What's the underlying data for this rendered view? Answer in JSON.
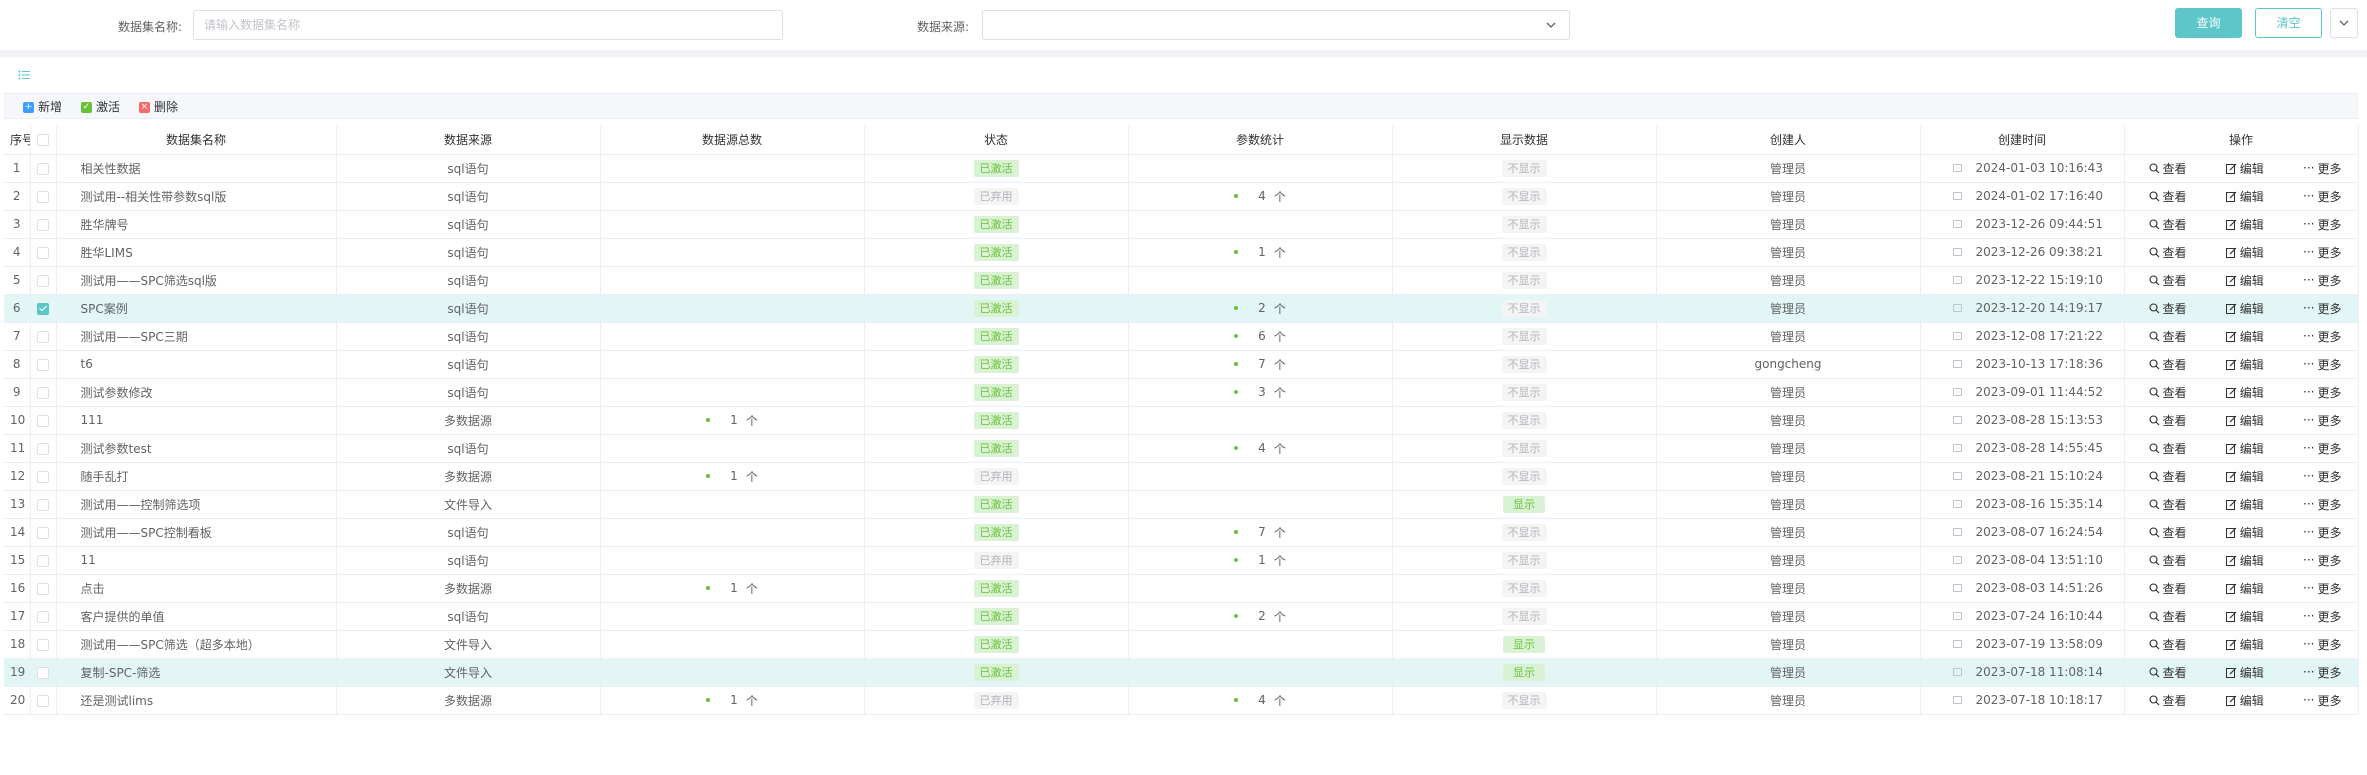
{
  "search": {
    "name_label": "数据集名称:",
    "name_placeholder": "请输入数据集名称",
    "name_value": "",
    "source_label": "数据来源:",
    "source_value": "",
    "query_label": "查询",
    "clear_label": "清空"
  },
  "toolbar": {
    "add_label": "新增",
    "activate_label": "激活",
    "delete_label": "删除"
  },
  "columns": [
    "序号",
    "",
    "数据集名称",
    "数据来源",
    "数据源总数",
    "状态",
    "参数统计",
    "显示数据",
    "创建人",
    "创建时间",
    "操作"
  ],
  "actions": {
    "view": "查看",
    "edit": "编辑",
    "more": "更多"
  },
  "status_labels": {
    "active": "已激活",
    "disabled": "已弃用"
  },
  "display_labels": {
    "show": "显示",
    "hide": "不显示"
  },
  "unit": "个",
  "rows": [
    {
      "no": "1",
      "name": "相关性数据",
      "source": "sql语句",
      "sources_total": "",
      "status": "已激活",
      "params": "",
      "display": "不显示",
      "creator": "管理员",
      "time": "2024-01-03 10:16:43",
      "checked": false,
      "highlight": false
    },
    {
      "no": "2",
      "name": "测试用--相关性带参数sql版",
      "source": "sql语句",
      "sources_total": "",
      "status": "已弃用",
      "params": "4",
      "display": "不显示",
      "creator": "管理员",
      "time": "2024-01-02 17:16:40",
      "checked": false,
      "highlight": false
    },
    {
      "no": "3",
      "name": "胜华牌号",
      "source": "sql语句",
      "sources_total": "",
      "status": "已激活",
      "params": "",
      "display": "不显示",
      "creator": "管理员",
      "time": "2023-12-26 09:44:51",
      "checked": false,
      "highlight": false
    },
    {
      "no": "4",
      "name": "胜华LIMS",
      "source": "sql语句",
      "sources_total": "",
      "status": "已激活",
      "params": "1",
      "display": "不显示",
      "creator": "管理员",
      "time": "2023-12-26 09:38:21",
      "checked": false,
      "highlight": false
    },
    {
      "no": "5",
      "name": "测试用——SPC筛选sql版",
      "source": "sql语句",
      "sources_total": "",
      "status": "已激活",
      "params": "",
      "display": "不显示",
      "creator": "管理员",
      "time": "2023-12-22 15:19:10",
      "checked": false,
      "highlight": false
    },
    {
      "no": "6",
      "name": "SPC案例",
      "source": "sql语句",
      "sources_total": "",
      "status": "已激活",
      "params": "2",
      "display": "不显示",
      "creator": "管理员",
      "time": "2023-12-20 14:19:17",
      "checked": true,
      "highlight": true
    },
    {
      "no": "7",
      "name": "测试用——SPC三期",
      "source": "sql语句",
      "sources_total": "",
      "status": "已激活",
      "params": "6",
      "display": "不显示",
      "creator": "管理员",
      "time": "2023-12-08 17:21:22",
      "checked": false,
      "highlight": false
    },
    {
      "no": "8",
      "name": "t6",
      "source": "sql语句",
      "sources_total": "",
      "status": "已激活",
      "params": "7",
      "display": "不显示",
      "creator": "gongcheng",
      "time": "2023-10-13 17:18:36",
      "checked": false,
      "highlight": false
    },
    {
      "no": "9",
      "name": "测试参数修改",
      "source": "sql语句",
      "sources_total": "",
      "status": "已激活",
      "params": "3",
      "display": "不显示",
      "creator": "管理员",
      "time": "2023-09-01 11:44:52",
      "checked": false,
      "highlight": false
    },
    {
      "no": "10",
      "name": "111",
      "source": "多数据源",
      "sources_total": "1",
      "status": "已激活",
      "params": "",
      "display": "不显示",
      "creator": "管理员",
      "time": "2023-08-28 15:13:53",
      "checked": false,
      "highlight": false
    },
    {
      "no": "11",
      "name": "测试参数test",
      "source": "sql语句",
      "sources_total": "",
      "status": "已激活",
      "params": "4",
      "display": "不显示",
      "creator": "管理员",
      "time": "2023-08-28 14:55:45",
      "checked": false,
      "highlight": false
    },
    {
      "no": "12",
      "name": "随手乱打",
      "source": "多数据源",
      "sources_total": "1",
      "status": "已弃用",
      "params": "",
      "display": "不显示",
      "creator": "管理员",
      "time": "2023-08-21 15:10:24",
      "checked": false,
      "highlight": false
    },
    {
      "no": "13",
      "name": "测试用——控制筛选项",
      "source": "文件导入",
      "sources_total": "",
      "status": "已激活",
      "params": "",
      "display": "显示",
      "creator": "管理员",
      "time": "2023-08-16 15:35:14",
      "checked": false,
      "highlight": false
    },
    {
      "no": "14",
      "name": "测试用——SPC控制看板",
      "source": "sql语句",
      "sources_total": "",
      "status": "已激活",
      "params": "7",
      "display": "不显示",
      "creator": "管理员",
      "time": "2023-08-07 16:24:54",
      "checked": false,
      "highlight": false
    },
    {
      "no": "15",
      "name": "11",
      "source": "sql语句",
      "sources_total": "",
      "status": "已弃用",
      "params": "1",
      "display": "不显示",
      "creator": "管理员",
      "time": "2023-08-04 13:51:10",
      "checked": false,
      "highlight": false
    },
    {
      "no": "16",
      "name": "点击",
      "source": "多数据源",
      "sources_total": "1",
      "status": "已激活",
      "params": "",
      "display": "不显示",
      "creator": "管理员",
      "time": "2023-08-03 14:51:26",
      "checked": false,
      "highlight": false
    },
    {
      "no": "17",
      "name": "客户提供的单值",
      "source": "sql语句",
      "sources_total": "",
      "status": "已激活",
      "params": "2",
      "display": "不显示",
      "creator": "管理员",
      "time": "2023-07-24 16:10:44",
      "checked": false,
      "highlight": false
    },
    {
      "no": "18",
      "name": "测试用——SPC筛选（超多本地）",
      "source": "文件导入",
      "sources_total": "",
      "status": "已激活",
      "params": "",
      "display": "显示",
      "creator": "管理员",
      "time": "2023-07-19 13:58:09",
      "checked": false,
      "highlight": false
    },
    {
      "no": "19",
      "name": "复制-SPC-筛选",
      "source": "文件导入",
      "sources_total": "",
      "status": "已激活",
      "params": "",
      "display": "显示",
      "creator": "管理员",
      "time": "2023-07-18 11:08:14",
      "checked": false,
      "highlight": true
    },
    {
      "no": "20",
      "name": "还是测试lims",
      "source": "多数据源",
      "sources_total": "1",
      "status": "已弃用",
      "params": "4",
      "display": "不显示",
      "creator": "管理员",
      "time": "2023-07-18 10:18:17",
      "checked": false,
      "highlight": false
    }
  ]
}
